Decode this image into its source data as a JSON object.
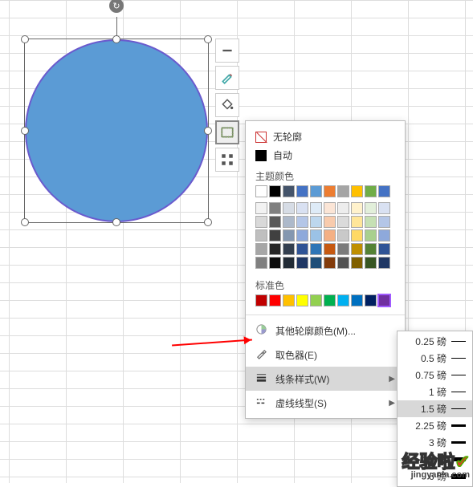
{
  "toolbar": {
    "items": [
      "minus",
      "brush",
      "fill",
      "outline",
      "more"
    ],
    "selected": "outline"
  },
  "outline_panel": {
    "no_outline_label": "无轮廓",
    "auto_label": "自动",
    "theme_label": "主题颜色",
    "theme_colors": [
      "#ffffff",
      "#000000",
      "#44546a",
      "#4472c4",
      "#5b9bd5",
      "#ed7d31",
      "#a5a5a5",
      "#ffc000",
      "#70ad47",
      "#4472c4"
    ],
    "theme_shades": [
      [
        "#f2f2f2",
        "#7f7f7f",
        "#d6dce5",
        "#d9e1f2",
        "#deebf7",
        "#fbe5d6",
        "#ededed",
        "#fff2cc",
        "#e2efda",
        "#d9e1f2"
      ],
      [
        "#d9d9d9",
        "#595959",
        "#adb9ca",
        "#b4c6e7",
        "#bdd7ee",
        "#f8cbad",
        "#dbdbdb",
        "#ffe699",
        "#c6e0b4",
        "#b4c6e7"
      ],
      [
        "#bfbfbf",
        "#404040",
        "#8497b0",
        "#8ea9db",
        "#9bc2e6",
        "#f4b084",
        "#c9c9c9",
        "#ffd966",
        "#a9d08e",
        "#8ea9db"
      ],
      [
        "#a6a6a6",
        "#262626",
        "#333f4f",
        "#305496",
        "#2e75b6",
        "#c65911",
        "#7b7b7b",
        "#bf8f00",
        "#548235",
        "#305496"
      ],
      [
        "#808080",
        "#0d0d0d",
        "#222b35",
        "#203764",
        "#1f4e78",
        "#833c0c",
        "#525252",
        "#806000",
        "#375623",
        "#203764"
      ]
    ],
    "standard_label": "标准色",
    "standard_colors": [
      "#c00000",
      "#ff0000",
      "#ffc000",
      "#ffff00",
      "#92d050",
      "#00b050",
      "#00b0f0",
      "#0070c0",
      "#002060",
      "#7030a0"
    ],
    "selected_standard_index": 9,
    "more_colors_label": "其他轮廓颜色(M)...",
    "eyedropper_label": "取色器(E)",
    "weight_label": "线条样式(W)",
    "dashes_label": "虚线线型(S)",
    "hovered": "weight"
  },
  "weight_submenu": {
    "unit": "磅",
    "options": [
      0.25,
      0.5,
      0.75,
      1,
      1.5,
      2.25,
      3,
      4.5,
      6
    ],
    "hovered_index": 4
  },
  "watermark": {
    "title": "经验啦",
    "sub": "jingyanla.com"
  }
}
